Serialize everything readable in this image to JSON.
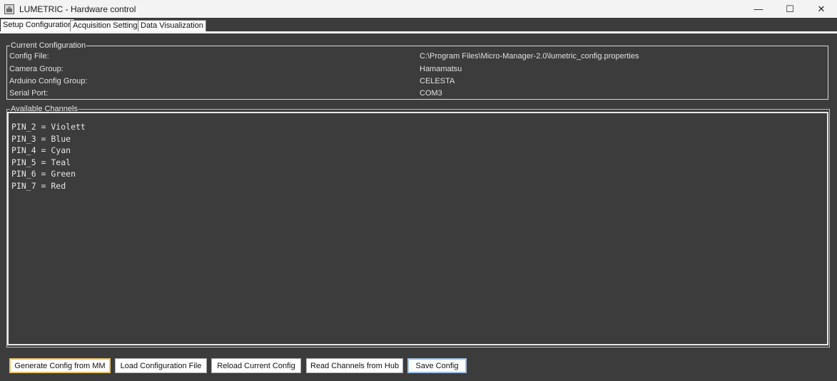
{
  "window": {
    "title": "LUMETRIC - Hardware control",
    "minimize_glyph": "—",
    "maximize_glyph": "☐",
    "close_glyph": "✕"
  },
  "tabs": [
    {
      "label": "Setup Configuration",
      "active": true
    },
    {
      "label": "Acquisition Settings",
      "active": false
    },
    {
      "label": "Data Visualization",
      "active": false
    }
  ],
  "current_config": {
    "title": "Current Configuration",
    "rows": [
      {
        "label": "Config File:",
        "value": "C:\\Program Files\\Micro-Manager-2.0\\lumetric_config.properties"
      },
      {
        "label": "Camera Group:",
        "value": "Hamamatsu"
      },
      {
        "label": "Arduino Config Group:",
        "value": "CELESTA"
      },
      {
        "label": "Serial Port:",
        "value": "COM3"
      }
    ]
  },
  "channels": {
    "title": "Available Channels",
    "lines": [
      "PIN_2 = Violett",
      "PIN_3 = Blue",
      "PIN_4 = Cyan",
      "PIN_5 = Teal",
      "PIN_6 = Green",
      "PIN_7 = Red"
    ]
  },
  "buttons": {
    "generate": "Generate Config from MM",
    "load": "Load Configuration File",
    "reload": "Reload Current Config",
    "read_channels": "Read Channels from Hub",
    "save": "Save Config"
  },
  "colors": {
    "background": "#3c3c3c",
    "titlebar": "#f3f3f3",
    "focus_yellow": "#e9c46a",
    "focus_blue": "#9ec1e6"
  }
}
